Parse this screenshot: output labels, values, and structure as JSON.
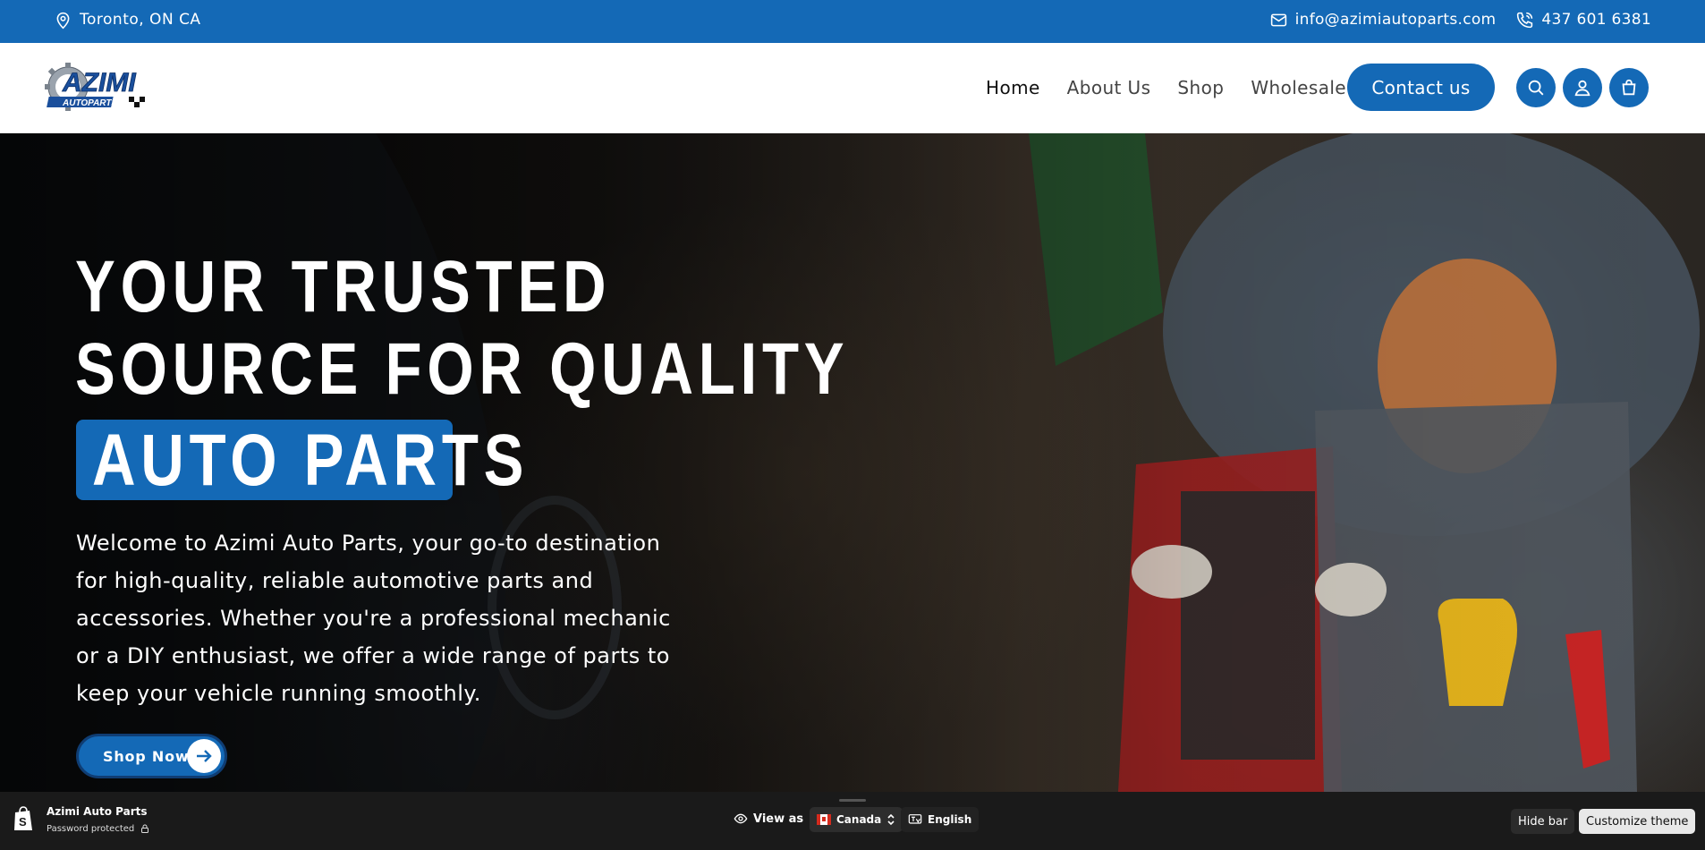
{
  "topbar": {
    "location": "Toronto, ON CA",
    "email": "info@azimiautoparts.com",
    "phone": "437 601 6381"
  },
  "brand": {
    "logo_main": "AZIMI",
    "logo_sub": "AUTOPARTS"
  },
  "nav": {
    "items": [
      {
        "label": "Home",
        "active": true
      },
      {
        "label": "About Us",
        "active": false
      },
      {
        "label": "Shop",
        "active": false
      },
      {
        "label": "Wholesale",
        "active": false
      }
    ],
    "contact_label": "Contact us",
    "icons": [
      "search-icon",
      "account-icon",
      "cart-icon"
    ]
  },
  "hero": {
    "title_line1": "YOUR TRUSTED",
    "title_line2": "SOURCE FOR QUALITY",
    "highlight": "AUTO PARTS",
    "description": "Welcome to Azimi Auto Parts, your go-to destination for high-quality, reliable automotive parts and accessories. Whether you're a professional mechanic or a DIY enthusiast, we offer a wide range of parts to keep your vehicle running smoothly.",
    "cta_label": "Shop Now"
  },
  "preview_bar": {
    "store_name": "Azimi Auto Parts",
    "status": "Password protected",
    "view_as": "View as",
    "country": "Canada",
    "language": "English",
    "hide_bar": "Hide bar",
    "customize": "Customize theme"
  },
  "colors": {
    "brand_blue": "#1469b6",
    "bar_dark": "#1a1a1a"
  }
}
